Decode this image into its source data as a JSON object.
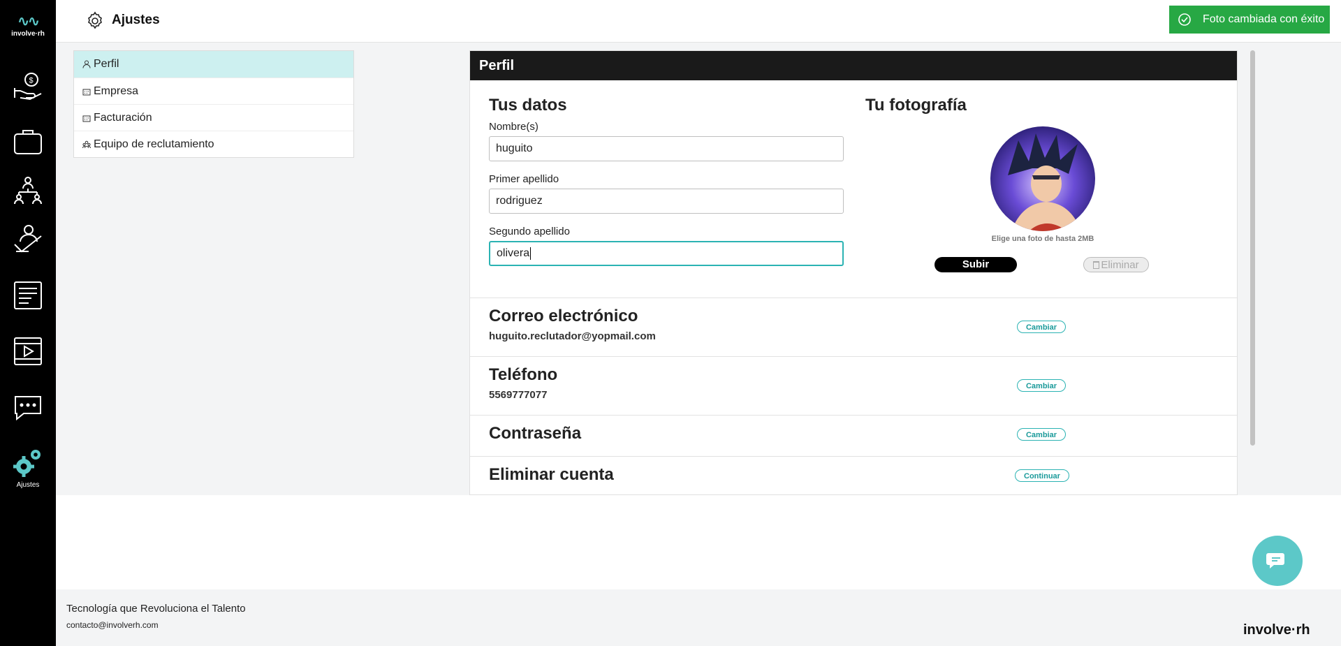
{
  "brand": {
    "logo_text": "involve·rh",
    "accent": "#5cc8c8",
    "footer_logo": "involve·rh"
  },
  "sidebar": {
    "items": [
      {
        "icon": "money-hand-icon"
      },
      {
        "icon": "briefcase-icon"
      },
      {
        "icon": "team-icon"
      },
      {
        "icon": "checklist-hand-icon"
      },
      {
        "icon": "receipt-icon"
      },
      {
        "icon": "video-icon"
      },
      {
        "icon": "chat-icon"
      },
      {
        "icon": "settings-gears-icon",
        "label": "Ajustes",
        "active": true
      }
    ]
  },
  "header": {
    "title": "Ajustes",
    "icon": "gear-icon"
  },
  "toast": {
    "text": "Foto cambiada con éxito",
    "color": "#27a844",
    "icon": "check-circle-icon"
  },
  "settings_menu": {
    "items": [
      {
        "label": "Perfil",
        "icon": "user-icon",
        "active": true
      },
      {
        "label": "Empresa",
        "icon": "building-icon"
      },
      {
        "label": "Facturación",
        "icon": "building-icon"
      },
      {
        "label": "Equipo de reclutamiento",
        "icon": "team-icon"
      }
    ]
  },
  "profile": {
    "panel_title": "Perfil",
    "data_title": "Tus datos",
    "fields": [
      {
        "label": "Nombre(s)",
        "value": "huguito"
      },
      {
        "label": "Primer apellido",
        "value": "rodriguez"
      },
      {
        "label": "Segundo apellido",
        "value": "olivera",
        "focused": true
      }
    ],
    "photo_title": "Tu fotografía",
    "photo_hint": "Elige una foto de hasta 2MB",
    "upload_label": "Subir",
    "delete_label": "Eliminar"
  },
  "account_rows": [
    {
      "title": "Correo electrónico",
      "value": "huguito.reclutador@yopmail.com",
      "action": "Cambiar"
    },
    {
      "title": "Teléfono",
      "value": "5569777077",
      "action": "Cambiar"
    },
    {
      "title": "Contraseña",
      "action": "Cambiar"
    },
    {
      "title": "Eliminar cuenta",
      "action": "Continuar"
    }
  ],
  "footer": {
    "tagline": "Tecnología que Revoluciona el Talento",
    "email": "contacto@involverh.com"
  }
}
